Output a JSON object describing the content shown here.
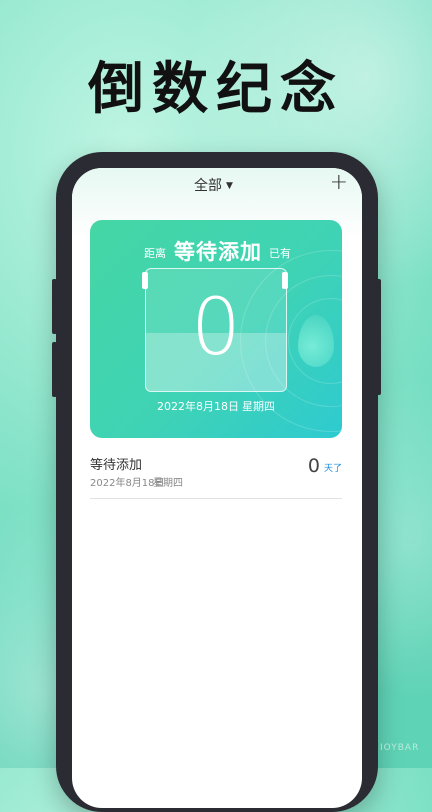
{
  "banner": {
    "title": "倒数纪念"
  },
  "header": {
    "tab_label": "全部",
    "add_symbol": "+"
  },
  "card": {
    "left_label": "距离",
    "title": "等待添加",
    "right_label": "已有",
    "count": "0",
    "date": "2022年8月18日",
    "weekday": "星期四"
  },
  "list": [
    {
      "title": "等待添加",
      "date": "2022年8月18日",
      "weekday": "星期四",
      "count": "0",
      "unit": "天了"
    }
  ],
  "watermark": "IOYBAR",
  "colors": {
    "accent": "#3fd3b5",
    "unit_blue": "#1e8fe0"
  }
}
